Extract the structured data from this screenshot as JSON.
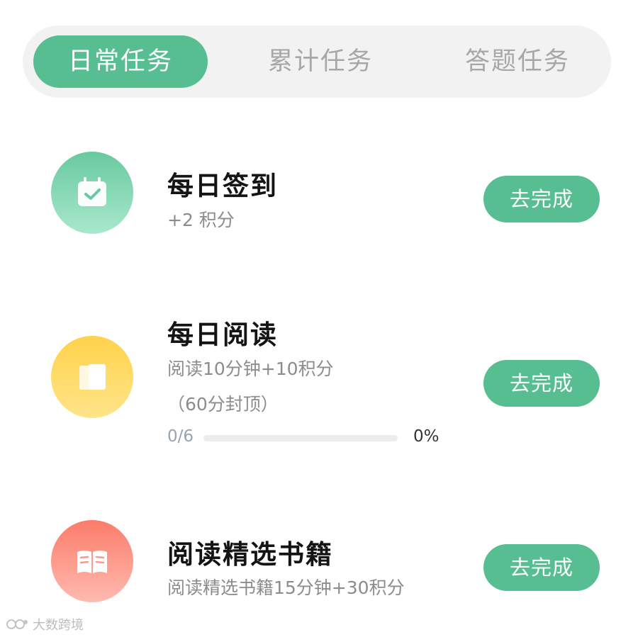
{
  "tabs": [
    {
      "label": "日常任务",
      "active": true
    },
    {
      "label": "累计任务",
      "active": false
    },
    {
      "label": "答题任务",
      "active": false
    }
  ],
  "tasks": [
    {
      "title": "每日签到",
      "subtitle": "+2 积分",
      "button": "去完成",
      "icon": "calendar-check-icon",
      "color": "#69c9a0"
    },
    {
      "title": "每日阅读",
      "subtitle": "阅读10分钟+10积分",
      "subtitle2": "（60分封顶）",
      "button": "去完成",
      "icon": "book-icon",
      "color": "#ffd24a",
      "progress": {
        "count": "0/6",
        "percent_label": "0%",
        "value": 0
      }
    },
    {
      "title": "阅读精选书籍",
      "subtitle": "阅读精选书籍15分钟+30积分",
      "button": "去完成",
      "icon": "open-book-icon",
      "color": "#fb7c6a"
    }
  ],
  "watermark": {
    "text": "大数跨境",
    "icon": "watermark-logo-icon"
  },
  "colors": {
    "accent": "#57be92",
    "tab_bg": "#f2f2f2"
  }
}
